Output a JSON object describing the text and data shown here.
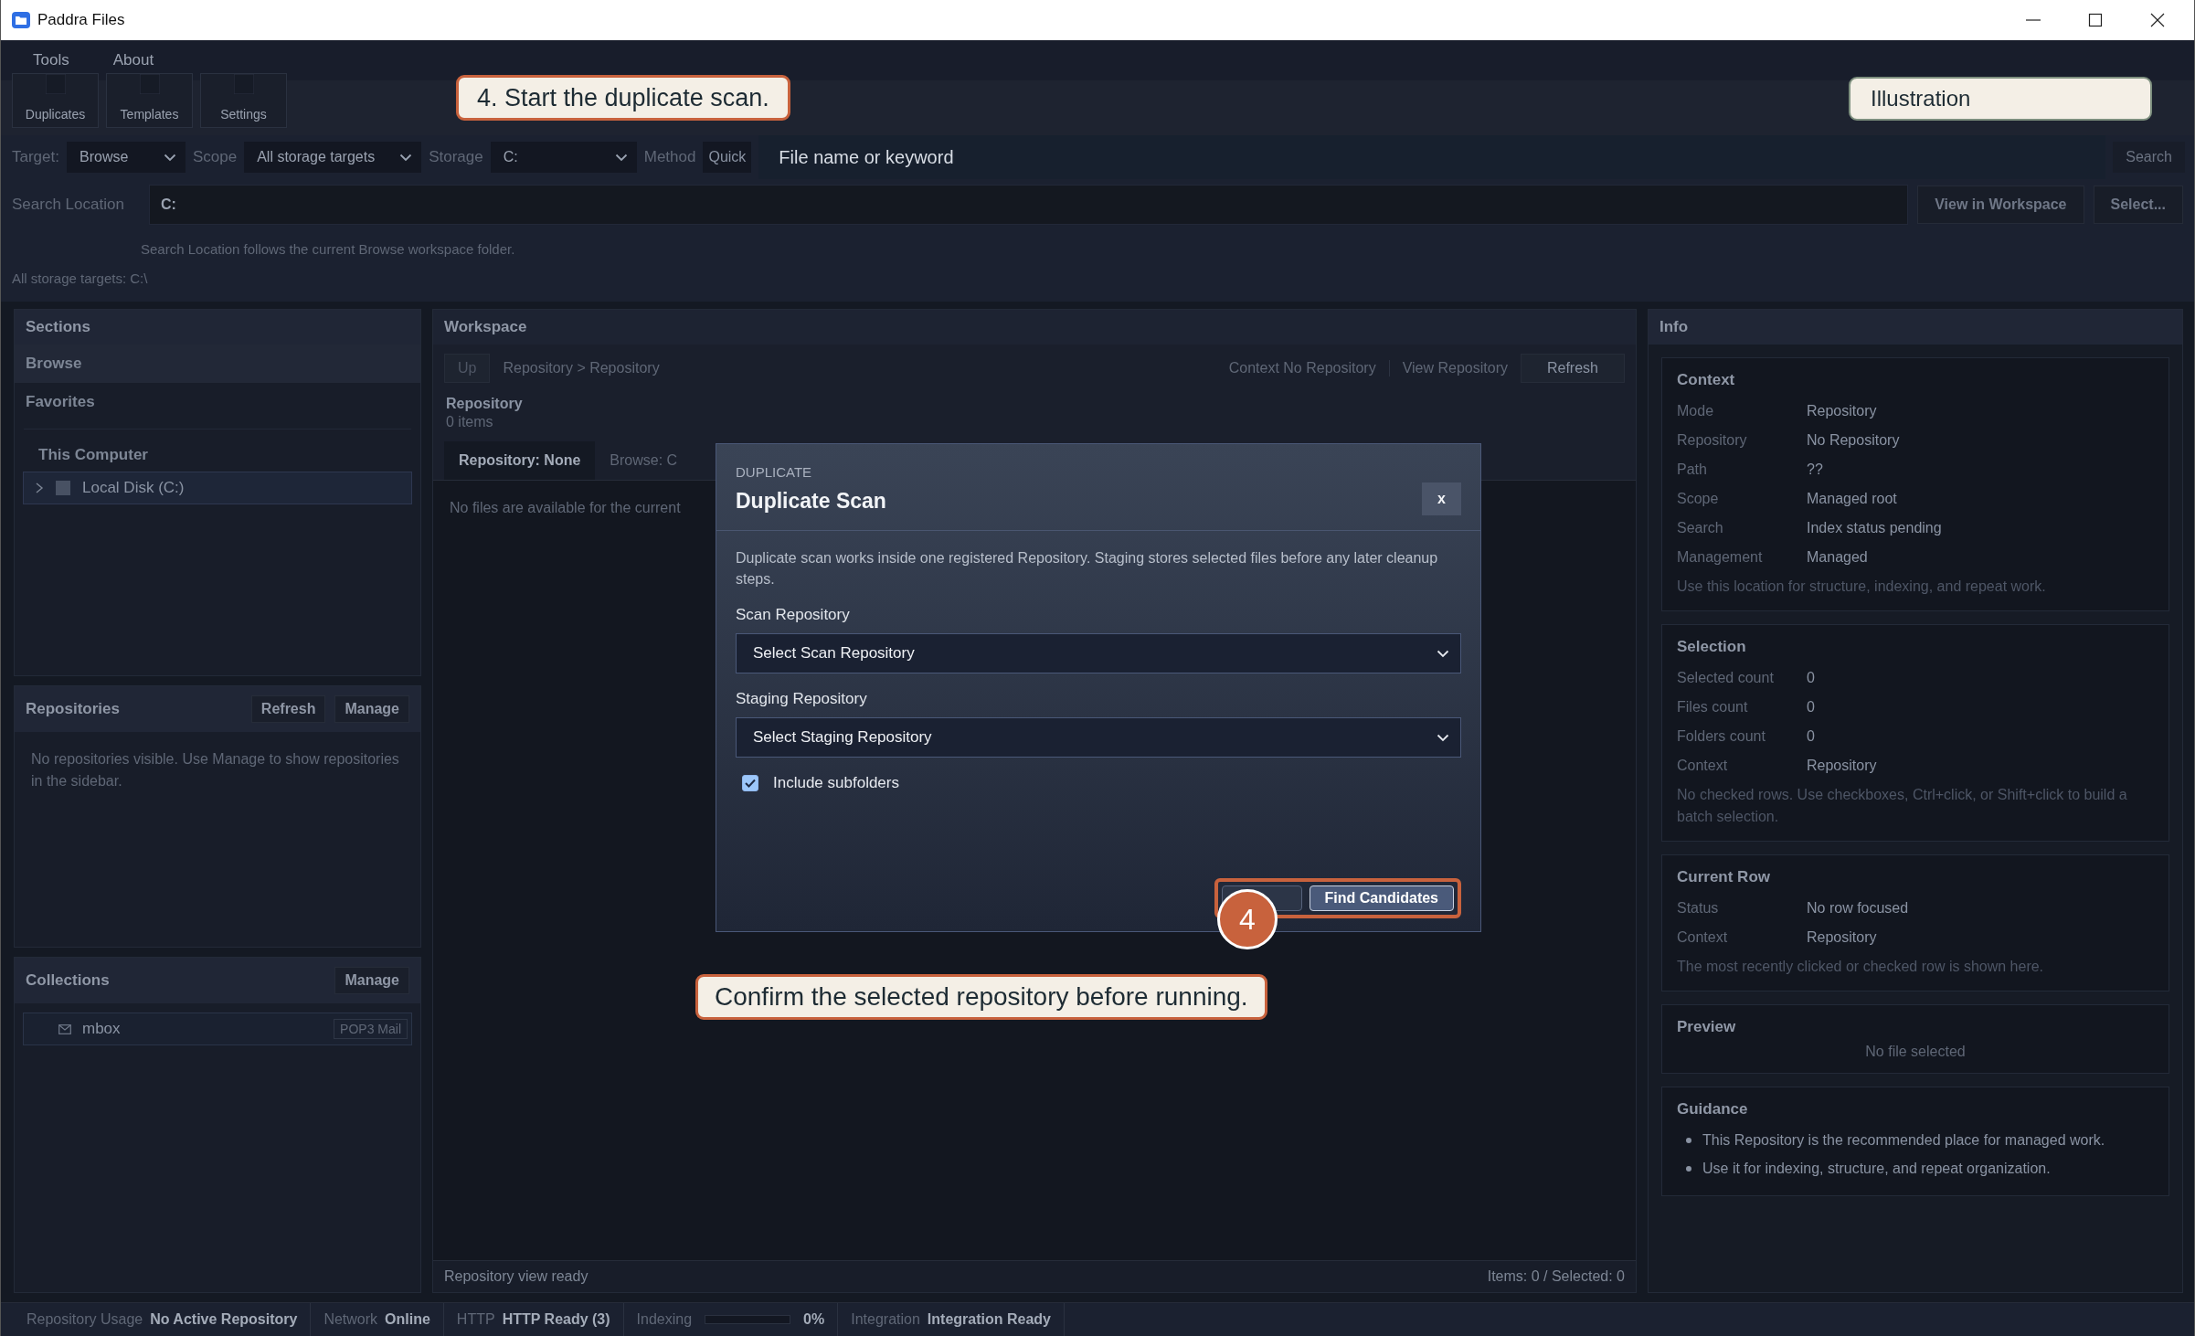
{
  "window": {
    "title": "Paddra Files"
  },
  "menu": [
    "Tools",
    "About"
  ],
  "toolbar": [
    {
      "label": "Duplicates"
    },
    {
      "label": "Templates"
    },
    {
      "label": "Settings"
    }
  ],
  "search_bar": {
    "target_label": "Target:",
    "target": "Browse",
    "scope_label": "Scope",
    "scope": "All storage targets",
    "storage_label": "Storage",
    "storage": "C:",
    "method_label": "Method",
    "method": "Quick",
    "query_placeholder": "File name or keyword",
    "search_button": "Search"
  },
  "location": {
    "label": "Search Location",
    "value": "C:",
    "buttons": [
      "View in Workspace",
      "Select..."
    ],
    "hint": "Search Location follows the current Browse workspace folder.",
    "targets_note": "All storage targets: C:\\"
  },
  "sections": {
    "title": "Sections",
    "items": [
      {
        "label": "Browse",
        "selected": true
      },
      {
        "label": "Favorites",
        "selected": false
      }
    ],
    "group": "This Computer",
    "drives": [
      {
        "label": "Local Disk (C:)",
        "expanded": false
      }
    ]
  },
  "repositories": {
    "title": "Repositories",
    "buttons": [
      "Refresh",
      "Manage"
    ],
    "empty": "No repositories visible. Use Manage to show repositories in the sidebar."
  },
  "collections": {
    "title": "Collections",
    "buttons": [
      "Manage"
    ],
    "items": [
      {
        "name": "mbox",
        "tag": "POP3 Mail"
      }
    ]
  },
  "workspace": {
    "title": "Workspace",
    "up": "Up",
    "breadcrumb": "Repository > Repository",
    "context": "Context No Repository",
    "view": "View Repository",
    "refresh": "Refresh",
    "heading": "Repository",
    "count": "0 items",
    "tabs": [
      {
        "label": "Repository: None",
        "selected": true
      },
      {
        "label": "Browse: C",
        "selected": false
      }
    ],
    "empty": "No files are available for the current",
    "status": "Repository view ready",
    "totals": "Items: 0 / Selected: 0"
  },
  "info": {
    "title": "Info",
    "cards": [
      {
        "title": "Context",
        "rows": [
          [
            "Mode",
            "Repository"
          ],
          [
            "Repository",
            "No Repository"
          ],
          [
            "Path",
            "??"
          ],
          [
            "Scope",
            "Managed root"
          ],
          [
            "Search",
            "Index status pending"
          ],
          [
            "Management",
            "Managed"
          ]
        ],
        "note": "Use this location for structure, indexing, and repeat work."
      },
      {
        "title": "Selection",
        "rows": [
          [
            "Selected count",
            "0"
          ],
          [
            "Files count",
            "0"
          ],
          [
            "Folders count",
            "0"
          ],
          [
            "Context",
            "Repository"
          ]
        ],
        "note": "No checked rows. Use checkboxes, Ctrl+click, or Shift+click to build a batch selection."
      },
      {
        "title": "Current Row",
        "rows": [
          [
            "Status",
            "No row focused"
          ],
          [
            "Context",
            "Repository"
          ]
        ],
        "note": "The most recently clicked or checked row is shown here."
      },
      {
        "title": "Preview",
        "empty": "No file selected"
      },
      {
        "title": "Guidance",
        "bullets": [
          "This Repository is the recommended place for managed work.",
          "Use it for indexing, structure, and repeat organization."
        ]
      }
    ]
  },
  "status_bar": [
    {
      "kind": "text",
      "label": "Repository Usage",
      "value": "No Active Repository"
    },
    {
      "kind": "text",
      "label": "Network",
      "value": "Online"
    },
    {
      "kind": "text",
      "label": "HTTP",
      "value": "HTTP Ready (3)"
    },
    {
      "kind": "meter",
      "label": "Indexing",
      "level": 0,
      "value": "0%"
    },
    {
      "kind": "text",
      "label": "Integration",
      "value": "Integration Ready"
    }
  ],
  "dialog": {
    "eyebrow": "DUPLICATE",
    "title": "Duplicate Scan",
    "close": "x",
    "description": "Duplicate scan works inside one registered Repository. Staging stores selected files before any later cleanup steps.",
    "fields": [
      {
        "label": "Scan Repository",
        "value": "Select Scan Repository"
      },
      {
        "label": "Staging Repository",
        "value": "Select Staging Repository"
      }
    ],
    "include_subfolders": {
      "label": "Include subfolders",
      "checked": true
    },
    "primary_button": "Find Candidates"
  },
  "annotations": {
    "step_callout": "4. Start the duplicate scan.",
    "tag": "Illustration",
    "hint_callout": "Confirm the selected repository before running.",
    "badge": "4"
  }
}
